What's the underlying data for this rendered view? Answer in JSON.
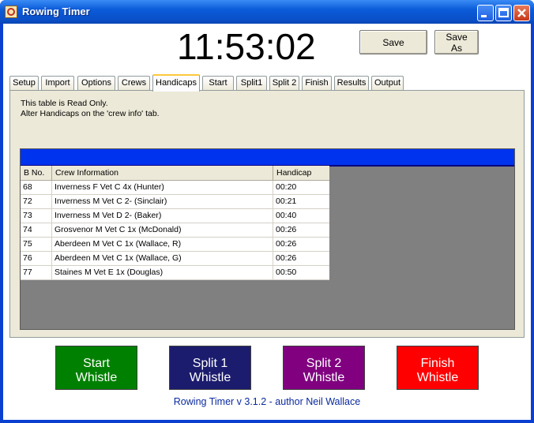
{
  "window": {
    "title": "Rowing Timer"
  },
  "clock": "11:53:02",
  "toolbar": {
    "save_label": "Save",
    "save_as_label": "Save As"
  },
  "tabs": [
    {
      "label": "Setup"
    },
    {
      "label": "Import"
    },
    {
      "label": "Options"
    },
    {
      "label": "Crews"
    },
    {
      "label": "Handicaps"
    },
    {
      "label": "Start"
    },
    {
      "label": "Split1"
    },
    {
      "label": "Split 2"
    },
    {
      "label": "Finish"
    },
    {
      "label": "Results"
    },
    {
      "label": "Output"
    }
  ],
  "active_tab": "Handicaps",
  "notes": {
    "line1": "This table is Read Only.",
    "line2": "Alter Handicaps on the 'crew info' tab."
  },
  "table": {
    "headers": [
      "B No.",
      "Crew Information",
      "Handicap"
    ],
    "rows": [
      [
        "68",
        "Inverness F Vet C 4x (Hunter)",
        "00:20"
      ],
      [
        "72",
        "Inverness M Vet C 2- (Sinclair)",
        "00:21"
      ],
      [
        "73",
        "Inverness M Vet D 2- (Baker)",
        "00:40"
      ],
      [
        "74",
        "Grosvenor M Vet C 1x (McDonald)",
        "00:26"
      ],
      [
        "75",
        "Aberdeen M Vet C 1x (Wallace, R)",
        "00:26"
      ],
      [
        "76",
        "Aberdeen M Vet C 1x (Wallace, G)",
        "00:26"
      ],
      [
        "77",
        "Staines M Vet E 1x (Douglas)",
        "00:50"
      ]
    ]
  },
  "actions": {
    "start": {
      "line1": "Start",
      "line2": "Whistle",
      "color": "#008000"
    },
    "split1": {
      "line1": "Split 1",
      "line2": "Whistle",
      "color": "#1c1c6e"
    },
    "split2": {
      "line1": "Split 2",
      "line2": "Whistle",
      "color": "#800080"
    },
    "finish": {
      "line1": "Finish",
      "line2": "Whistle",
      "color": "#ff0000"
    }
  },
  "footer": "Rowing Timer v 3.1.2 - author Neil Wallace",
  "icons": {
    "app": "stopwatch-icon",
    "min": "minimize-icon",
    "max": "maximize-icon",
    "close": "close-icon"
  }
}
